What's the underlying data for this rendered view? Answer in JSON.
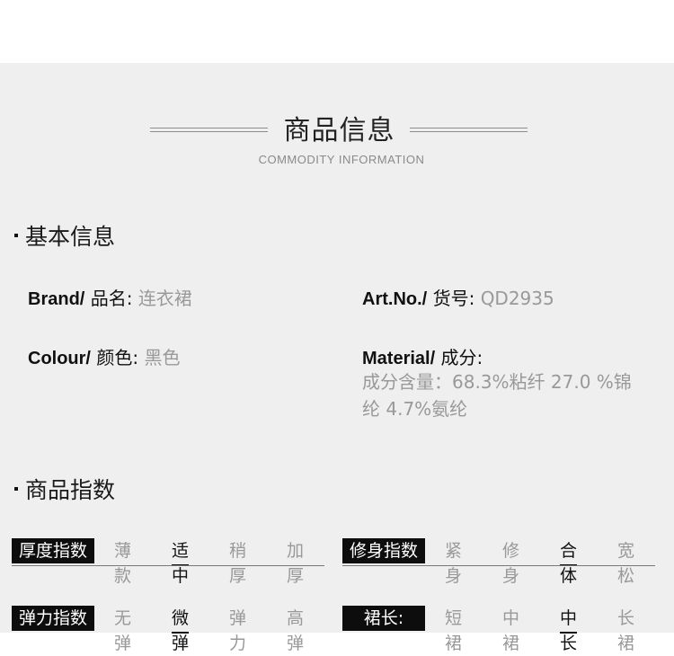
{
  "header": {
    "title": "商品信息",
    "subtitle": "COMMODITY INFORMATION"
  },
  "basic_info": {
    "heading": "基本信息",
    "brand": {
      "label_en": "Brand/",
      "label_zh": "品名:",
      "value": "连衣裙"
    },
    "art_no": {
      "label_en": "Art.No./",
      "label_zh": "货号:",
      "value": "QD2935"
    },
    "colour": {
      "label_en": "Colour/",
      "label_zh": "颜色:",
      "value": "黑色"
    },
    "material": {
      "label_en": "Material/",
      "label_zh": "成分:",
      "value_line1": "成分含量：68.3%粘纤  27.0 %锦",
      "value_line2": "纶  4.7%氨纶"
    }
  },
  "index_section": {
    "heading": "商品指数",
    "ratings": [
      {
        "tag": "厚度指数",
        "options": [
          "薄款",
          "适中",
          "稍厚",
          "加厚"
        ],
        "selected": "适中"
      },
      {
        "tag": "修身指数",
        "options": [
          "紧身",
          "修身",
          "合体",
          "宽松"
        ],
        "selected": "合体"
      },
      {
        "tag": "弹力指数",
        "options": [
          "无弹",
          "微弹",
          "弹力",
          "高弹"
        ],
        "selected": "微弹"
      },
      {
        "tag": "裙长:",
        "options": [
          "短裙",
          "中裙",
          "中长",
          "长裙"
        ],
        "selected": "中长"
      }
    ]
  }
}
